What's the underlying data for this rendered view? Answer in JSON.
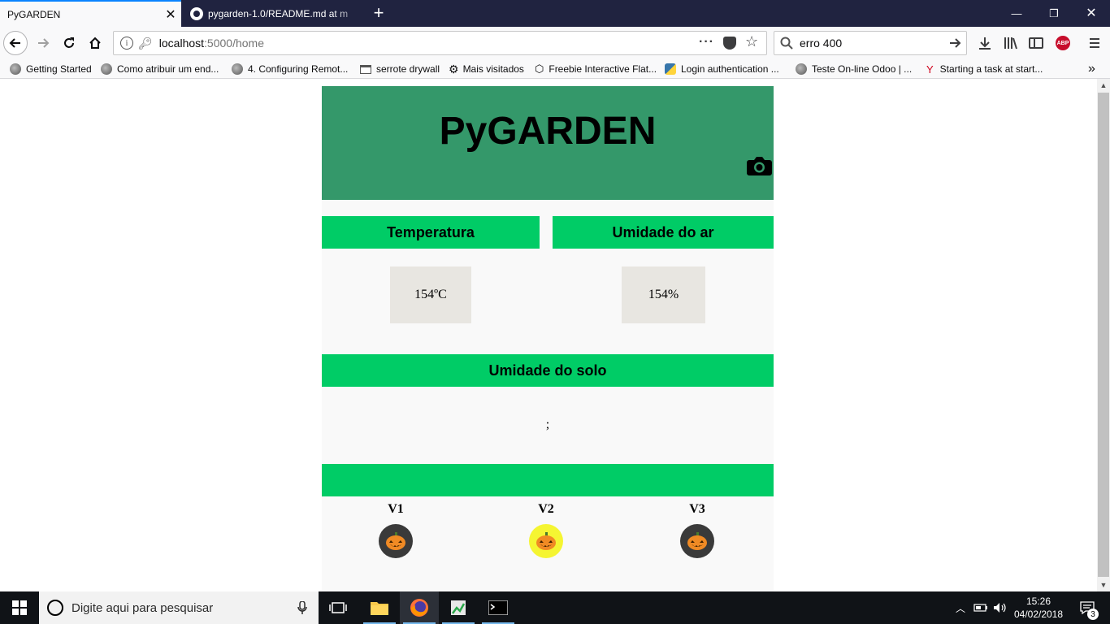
{
  "browser": {
    "tabs": [
      {
        "title": "PyGARDEN",
        "active": true
      },
      {
        "title": "pygarden-1.0/README.md at m",
        "active": false
      }
    ],
    "url_host": "localhost",
    "url_path": ":5000/home",
    "search_value": "erro 400",
    "bookmarks": [
      {
        "label": "Getting Started",
        "icon": "globe-icon"
      },
      {
        "label": "Como atribuir um end...",
        "icon": "globe-icon"
      },
      {
        "label": "4. Configuring Remot...",
        "icon": "globe-icon"
      },
      {
        "label": "serrote drywall",
        "icon": "folder-icon"
      },
      {
        "label": "Mais visitados",
        "icon": "gear-icon"
      },
      {
        "label": "Freebie Interactive Flat...",
        "icon": "cube-icon"
      },
      {
        "label": "Login authentication ...",
        "icon": "python-icon"
      },
      {
        "label": "Teste On-line Odoo | ...",
        "icon": "globe-icon"
      },
      {
        "label": "Starting a task at start...",
        "icon": "task-icon"
      }
    ],
    "abp_badge": "ABP"
  },
  "page": {
    "title": "PyGARDEN",
    "temperature": {
      "label": "Temperatura",
      "value": "154ºC"
    },
    "air_humidity": {
      "label": "Umidade do ar",
      "value": "154%"
    },
    "soil_humidity": {
      "label": "Umidade do solo",
      "value": ";"
    },
    "valves": [
      {
        "label": "V1",
        "state": "off"
      },
      {
        "label": "V2",
        "state": "on"
      },
      {
        "label": "V3",
        "state": "off"
      }
    ],
    "colors": {
      "header": "#34986a",
      "section": "#00cc66",
      "valve_on": "#f5f532",
      "valve_off": "#3a3a3a"
    }
  },
  "taskbar": {
    "search_placeholder": "Digite aqui para pesquisar",
    "time": "15:26",
    "date": "04/02/2018",
    "notification_count": "3"
  }
}
